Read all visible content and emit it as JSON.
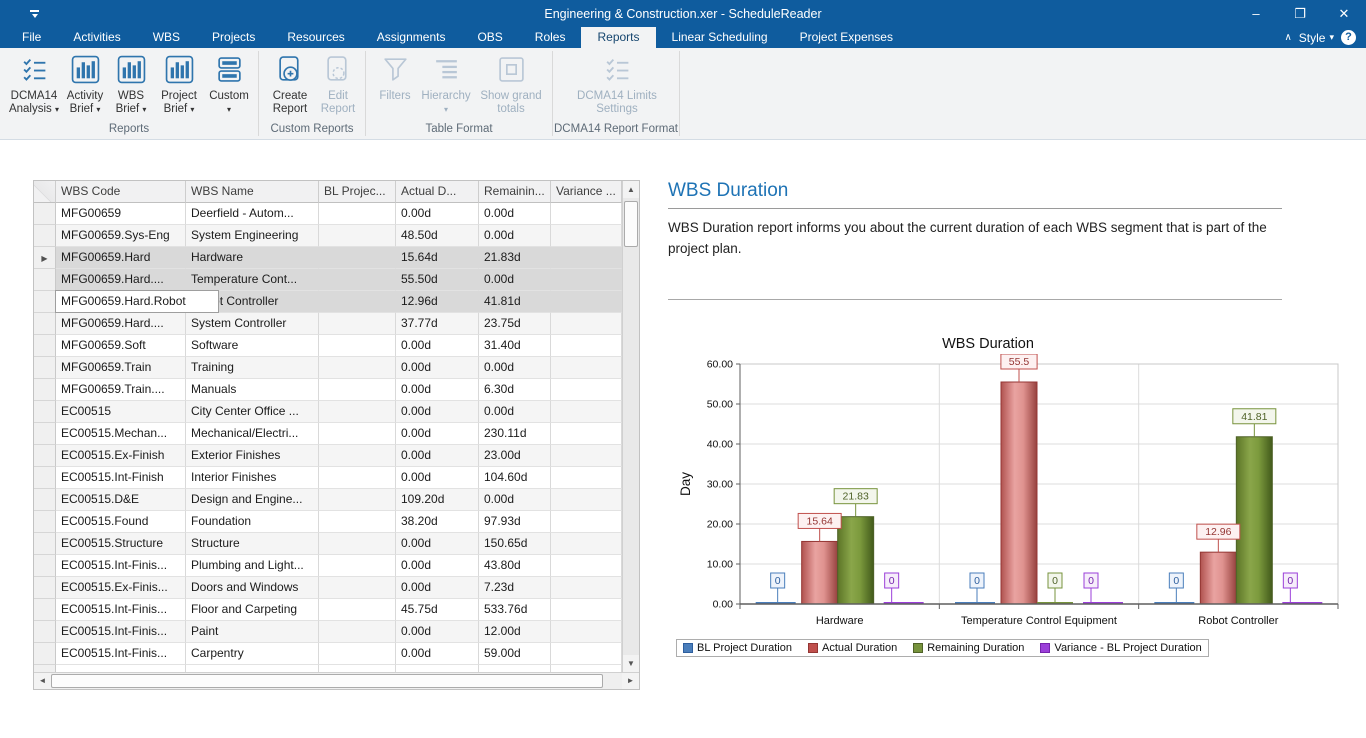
{
  "window": {
    "title": "Engineering & Construction.xer - ScheduleReader",
    "controls": {
      "minimize": "–",
      "restore": "❐",
      "close": "✕"
    }
  },
  "icons": {
    "dropdown_caret": "▾",
    "row_arrow": "▶",
    "scroll_up": "▲",
    "scroll_down": "▼",
    "scroll_left": "◄",
    "scroll_right": "►",
    "collapse_ribbon": "∧",
    "help": "?"
  },
  "menubar": {
    "tabs": [
      {
        "label": "File"
      },
      {
        "label": "Activities"
      },
      {
        "label": "WBS"
      },
      {
        "label": "Projects"
      },
      {
        "label": "Resources"
      },
      {
        "label": "Assignments"
      },
      {
        "label": "OBS"
      },
      {
        "label": "Roles"
      },
      {
        "label": "Reports",
        "selected": true
      },
      {
        "label": "Linear Scheduling"
      },
      {
        "label": "Project Expenses"
      }
    ],
    "style_label": "Style"
  },
  "ribbon": {
    "groups": [
      {
        "label": "Reports",
        "buttons": [
          {
            "label": "DCMA14 Analysis",
            "icon": "checklist",
            "dropdown": true,
            "enabled": true
          },
          {
            "label": "Activity Brief",
            "icon": "bar-chart",
            "dropdown": true,
            "enabled": true
          },
          {
            "label": "WBS Brief",
            "icon": "bar-chart",
            "dropdown": true,
            "enabled": true
          },
          {
            "label": "Project Brief",
            "icon": "bar-chart",
            "dropdown": true,
            "enabled": true
          },
          {
            "label": "Custom",
            "icon": "layers",
            "dropdown": true,
            "enabled": true
          }
        ]
      },
      {
        "label": "Custom Reports",
        "buttons": [
          {
            "label": "Create Report",
            "icon": "add-report",
            "enabled": true
          },
          {
            "label": "Edit Report",
            "icon": "edit-report",
            "enabled": false
          }
        ]
      },
      {
        "label": "Table Format",
        "buttons": [
          {
            "label": "Filters",
            "icon": "funnel",
            "enabled": false
          },
          {
            "label": "Hierarchy",
            "icon": "hierarchy",
            "dropdown": true,
            "enabled": false
          },
          {
            "label": "Show grand totals",
            "icon": "grand-totals",
            "enabled": false
          }
        ]
      },
      {
        "label": "DCMA14 Report Format",
        "buttons": [
          {
            "label": "DCMA14 Limits Settings",
            "icon": "checklist",
            "enabled": false
          }
        ]
      }
    ]
  },
  "table": {
    "columns": [
      "WBS Code",
      "WBS Name",
      "BL Projec...",
      "Actual D...",
      "Remainin...",
      "Variance ..."
    ],
    "rows": [
      {
        "code": "MFG00659",
        "name": "Deerfield - Autom...",
        "bl": "",
        "actual": "0.00d",
        "remaining": "0.00d",
        "variance": ""
      },
      {
        "code": "MFG00659.Sys-Eng",
        "name": "System Engineering",
        "bl": "",
        "actual": "48.50d",
        "remaining": "0.00d",
        "variance": ""
      },
      {
        "code": "MFG00659.Hard",
        "name": "Hardware",
        "bl": "",
        "actual": "15.64d",
        "remaining": "21.83d",
        "variance": "",
        "selected": true,
        "arrow": true
      },
      {
        "code": "MFG00659.Hard....",
        "name": "Temperature Cont...",
        "bl": "",
        "actual": "55.50d",
        "remaining": "0.00d",
        "variance": "",
        "selected": true
      },
      {
        "code": "MFG00659.Hard.Robot",
        "name": "Robot Controller",
        "bl": "",
        "actual": "12.96d",
        "remaining": "41.81d",
        "variance": "",
        "selected": true,
        "overlay": "MFG00659.Hard.Robot"
      },
      {
        "code": "MFG00659.Hard....",
        "name": "System Controller",
        "bl": "",
        "actual": "37.77d",
        "remaining": "23.75d",
        "variance": ""
      },
      {
        "code": "MFG00659.Soft",
        "name": "Software",
        "bl": "",
        "actual": "0.00d",
        "remaining": "31.40d",
        "variance": ""
      },
      {
        "code": "MFG00659.Train",
        "name": "Training",
        "bl": "",
        "actual": "0.00d",
        "remaining": "0.00d",
        "variance": ""
      },
      {
        "code": "MFG00659.Train....",
        "name": "Manuals",
        "bl": "",
        "actual": "0.00d",
        "remaining": "6.30d",
        "variance": ""
      },
      {
        "code": "EC00515",
        "name": "City Center Office ...",
        "bl": "",
        "actual": "0.00d",
        "remaining": "0.00d",
        "variance": ""
      },
      {
        "code": "EC00515.Mechan...",
        "name": "Mechanical/Electri...",
        "bl": "",
        "actual": "0.00d",
        "remaining": "230.11d",
        "variance": ""
      },
      {
        "code": "EC00515.Ex-Finish",
        "name": "Exterior Finishes",
        "bl": "",
        "actual": "0.00d",
        "remaining": "23.00d",
        "variance": ""
      },
      {
        "code": "EC00515.Int-Finish",
        "name": "Interior Finishes",
        "bl": "",
        "actual": "0.00d",
        "remaining": "104.60d",
        "variance": ""
      },
      {
        "code": "EC00515.D&E",
        "name": "Design and Engine...",
        "bl": "",
        "actual": "109.20d",
        "remaining": "0.00d",
        "variance": ""
      },
      {
        "code": "EC00515.Found",
        "name": "Foundation",
        "bl": "",
        "actual": "38.20d",
        "remaining": "97.93d",
        "variance": ""
      },
      {
        "code": "EC00515.Structure",
        "name": "Structure",
        "bl": "",
        "actual": "0.00d",
        "remaining": "150.65d",
        "variance": ""
      },
      {
        "code": "EC00515.Int-Finis...",
        "name": "Plumbing and Light...",
        "bl": "",
        "actual": "0.00d",
        "remaining": "43.80d",
        "variance": ""
      },
      {
        "code": "EC00515.Ex-Finis...",
        "name": "Doors and Windows",
        "bl": "",
        "actual": "0.00d",
        "remaining": "7.23d",
        "variance": ""
      },
      {
        "code": "EC00515.Int-Finis...",
        "name": "Floor and Carpeting",
        "bl": "",
        "actual": "45.75d",
        "remaining": "533.76d",
        "variance": ""
      },
      {
        "code": "EC00515.Int-Finis...",
        "name": "Paint",
        "bl": "",
        "actual": "0.00d",
        "remaining": "12.00d",
        "variance": ""
      },
      {
        "code": "EC00515.Int-Finis...",
        "name": "Carpentry",
        "bl": "",
        "actual": "0.00d",
        "remaining": "59.00d",
        "variance": ""
      }
    ]
  },
  "report": {
    "title": "WBS Duration",
    "description": "WBS Duration report informs you about the current duration of each WBS segment that is part of the project plan."
  },
  "chart_data": {
    "type": "bar",
    "title": "WBS Duration",
    "xlabel": "",
    "ylabel": "Day",
    "ylim": [
      0,
      60
    ],
    "ytick_step": 10,
    "grid": true,
    "legend_position": "bottom",
    "categories": [
      "Hardware",
      "Temperature Control Equipment",
      "Robot Controller"
    ],
    "series": [
      {
        "name": "BL Project Duration",
        "color": "#4a7ebb",
        "values": [
          0,
          0,
          0
        ],
        "labels": [
          "0",
          "0",
          "0"
        ]
      },
      {
        "name": "Actual Duration",
        "color": "#c0504d",
        "values": [
          15.64,
          55.5,
          12.96
        ],
        "labels": [
          "15.64",
          "55.5",
          "12.96"
        ]
      },
      {
        "name": "Remaining Duration",
        "color": "#77933c",
        "values": [
          21.83,
          0,
          41.81
        ],
        "labels": [
          "21.83",
          "0",
          "41.81"
        ]
      },
      {
        "name": "Variance - BL Project Duration",
        "color": "#9b3fd9",
        "values": [
          0,
          0,
          0
        ],
        "labels": [
          "0",
          "0",
          "0"
        ]
      }
    ]
  }
}
